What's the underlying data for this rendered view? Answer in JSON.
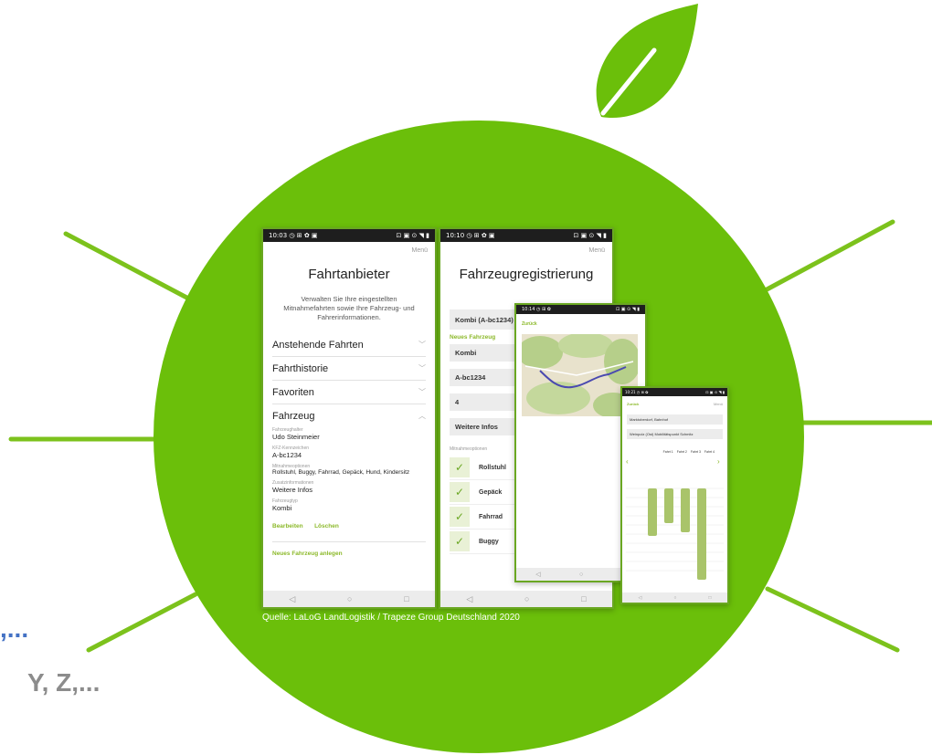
{
  "phone1": {
    "status_time": "10:03 ◷ ⊞ ✿ ▣",
    "status_icons": "⊡ ▣ ⊙ ◥ ▮",
    "menu": "Menü",
    "title": "Fahrtanbieter",
    "subtitle": "Verwalten Sie Ihre eingestellten Mitnahmefahrten sowie Ihre Fahrzeug- und Fahrerinformationen.",
    "sections": [
      "Anstehende Fahrten",
      "Fahrthistorie",
      "Favoriten",
      "Fahrzeug"
    ],
    "vehicle": {
      "holder_label": "Fahrzeughalter",
      "holder": "Udo Steinmeier",
      "plate_label": "KFZ-Kennzeichen",
      "plate": "A-bc1234",
      "transport_label": "Mitnahmeoptionen",
      "transport": "Rollstuhl, Buggy, Fahrrad, Gepäck, Hund, Kindersitz",
      "info_label": "Zusatzinformationen",
      "info": "Weitere Infos",
      "type_label": "Fahrzeugtyp",
      "type": "Kombi",
      "edit": "Bearbeiten",
      "delete": "Löschen",
      "new": "Neues Fahrzeug anlegen"
    }
  },
  "phone2": {
    "status_time": "10:10 ◷ ⊞ ✿ ▣",
    "status_icons": "⊡ ▣ ⊙ ◥ ▮",
    "menu": "Menü",
    "title": "Fahrzeugregistrierung",
    "selected": "Kombi (A-bc1234)",
    "new_vehicle": "Neues Fahrzeug",
    "fields": [
      "Kombi",
      "A-bc1234",
      "4",
      "Weitere Infos"
    ],
    "options_label": "Mitnahmeoptionen",
    "options": [
      "Rollstuhl",
      "Gepäck",
      "Fahrrad",
      "Buggy"
    ]
  },
  "phone3": {
    "status_time": "10:14 ◷ ⊞ ✿",
    "status_icons": "⊡ ▣ ⊙ ◥ ▮",
    "back": "Zurück"
  },
  "phone4": {
    "status_time": "10:21 ◷ ⊞ ✿",
    "status_icons": "⊡ ▣ ⊙ ◥ ▮",
    "back": "Zurück",
    "menu": "Menü",
    "from": "Marktoberdorf, Bahnhof",
    "to": "Weinpolz (Ost) Mobilitätspunkt Schmitz",
    "rides": [
      "Fahrt 1",
      "Fahrt 2",
      "Fahrt 3",
      "Fahrt 4"
    ]
  },
  "source": "Quelle: LaLoG LandLogistik / Trapeze Group Deutschland 2020",
  "side_text_1": ",...",
  "side_text_2": "Y, Z,...",
  "colors": {
    "brand_green": "#6bbf0a",
    "leaf_green": "#7cc21c",
    "accent_green": "#8cb92a",
    "blue_text": "#4472c4"
  }
}
